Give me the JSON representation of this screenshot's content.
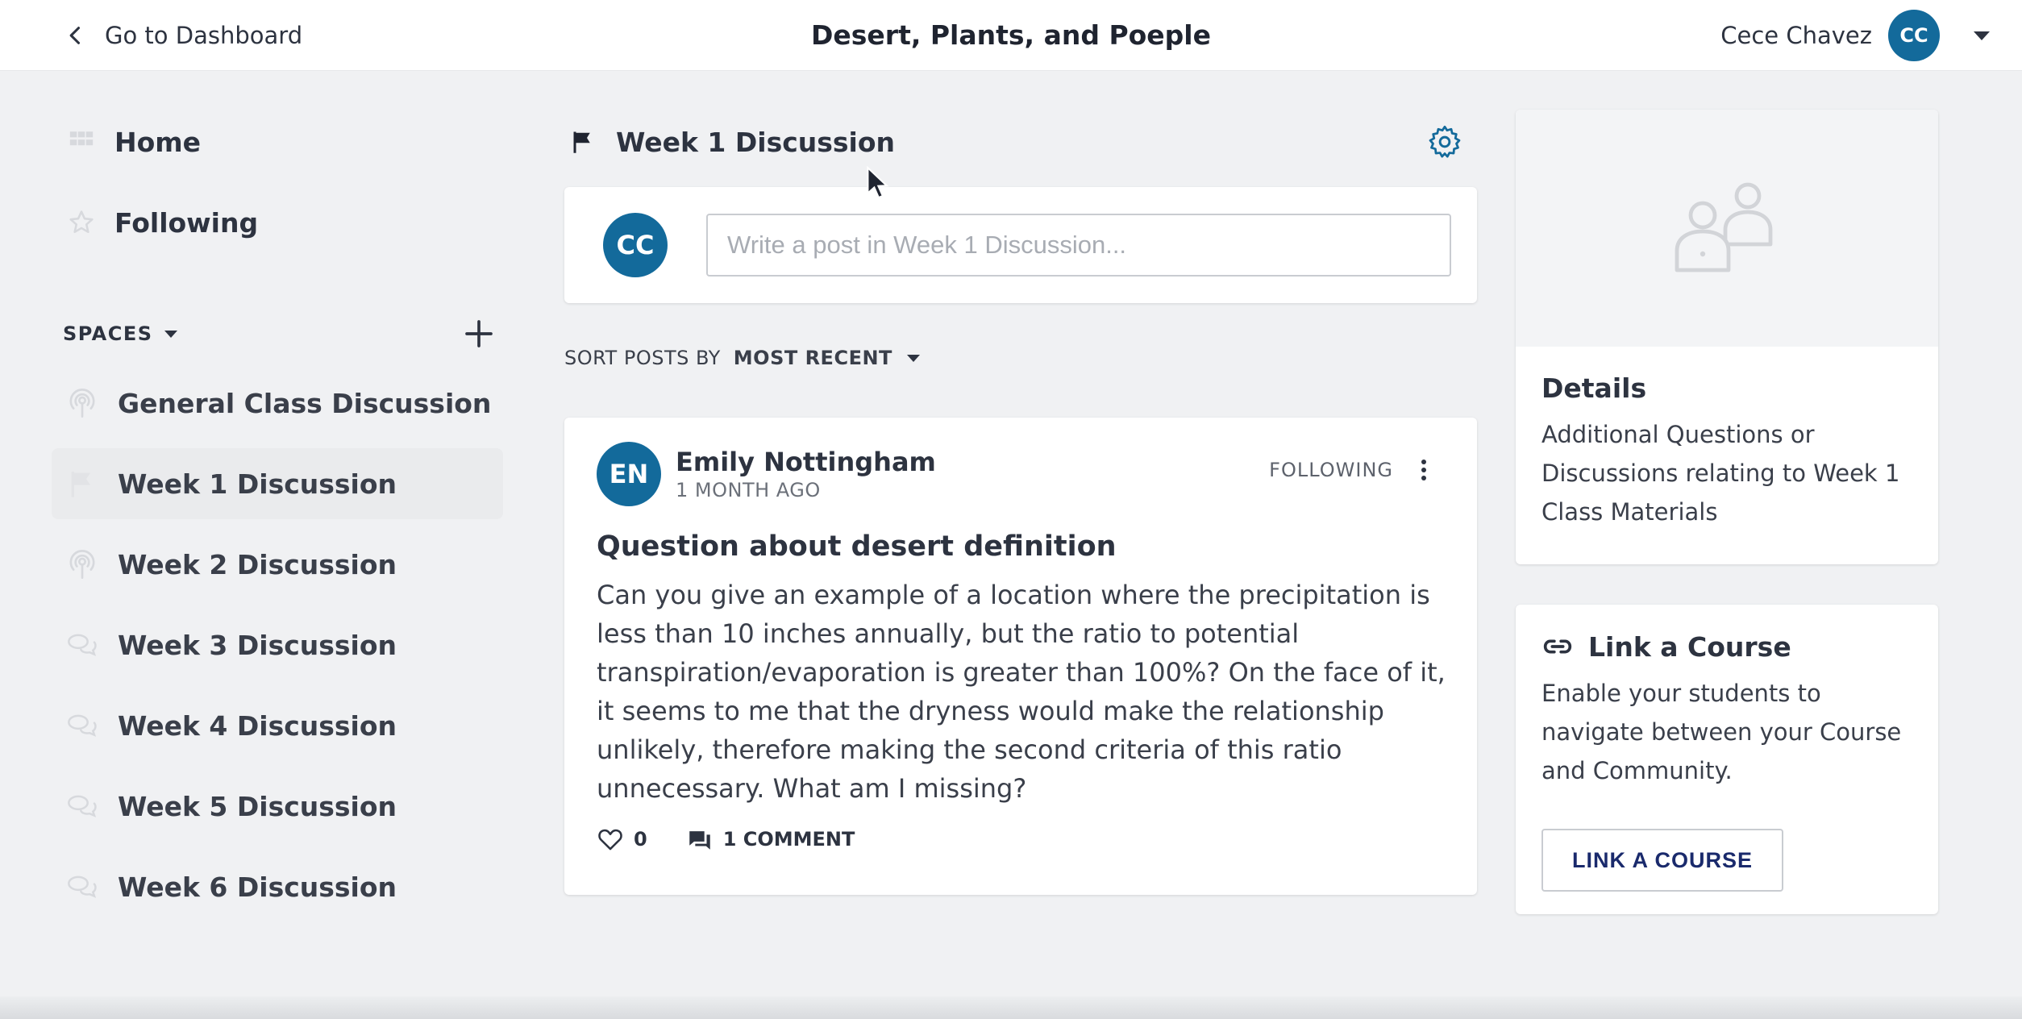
{
  "topbar": {
    "back_label": "Go to Dashboard",
    "course_title": "Desert, Plants, and Poeple",
    "user_name": "Cece Chavez",
    "user_initials": "CC"
  },
  "sidebar": {
    "nav": [
      {
        "label": "Home",
        "icon": "grid-icon"
      },
      {
        "label": "Following",
        "icon": "star-icon"
      }
    ],
    "spaces_label": "SPACES",
    "spaces": [
      {
        "label": "General Class Discussion",
        "icon": "broadcast-icon",
        "active": false
      },
      {
        "label": "Week 1 Discussion",
        "icon": "flag-icon",
        "active": true
      },
      {
        "label": "Week 2 Discussion",
        "icon": "broadcast-icon",
        "active": false
      },
      {
        "label": "Week 3 Discussion",
        "icon": "chat-bubbles-icon",
        "active": false
      },
      {
        "label": "Week 4 Discussion",
        "icon": "chat-bubbles-icon",
        "active": false
      },
      {
        "label": "Week 5 Discussion",
        "icon": "chat-bubbles-icon",
        "active": false
      },
      {
        "label": "Week 6 Discussion",
        "icon": "chat-bubbles-icon",
        "active": false
      }
    ]
  },
  "space": {
    "title": "Week 1 Discussion",
    "compose_placeholder": "Write a post in Week 1 Discussion...",
    "compose_initials": "CC",
    "sort_label": "SORT POSTS BY",
    "sort_value": "MOST RECENT"
  },
  "post": {
    "author_initials": "EN",
    "author_name": "Emily Nottingham",
    "time": "1 MONTH AGO",
    "follow_label": "FOLLOWING",
    "title": "Question about desert definition",
    "body": "Can you give an example of a location where the precipitation is less than 10 inches annually, but the ratio to potential transpiration/evaporation is greater than 100%? On the face of it, it seems to me that the dryness would make the relationship unlikely, therefore making the second criteria of this ratio unnecessary. What am I missing?",
    "likes": "0",
    "comments": "1 COMMENT"
  },
  "details": {
    "title": "Details",
    "text": "Additional Questions or Discussions relating to Week 1 Class Materials"
  },
  "link_course": {
    "title": "Link a Course",
    "text": "Enable your students to navigate between your Course and Community.",
    "button": "LINK A COURSE"
  },
  "colors": {
    "accent_avatar": "#136a9b",
    "background": "#f0f1f3",
    "link_button_text": "#1a2a6c"
  }
}
